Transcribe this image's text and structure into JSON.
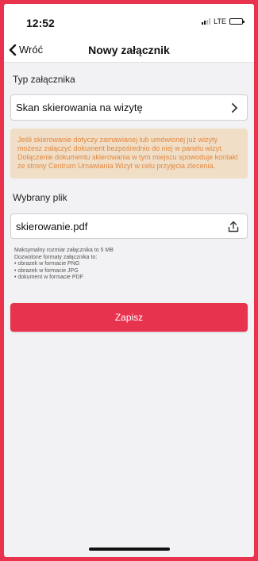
{
  "status": {
    "time": "12:52",
    "network": "LTE"
  },
  "nav": {
    "back_label": "Wróć",
    "title": "Nowy załącznik"
  },
  "attachment_type": {
    "label": "Typ załącznika",
    "value": "Skan skierowania na wizytę"
  },
  "info": {
    "line1": "Jeśli skierowanie dotyczy zamawianej lub umówionej już wizyty możesz załączyć dokument bezpośrednio do niej w panelu wizyt.",
    "line2": "Dołączenie dokumentu skierowania w tym miejscu spowoduje kontakt ze strony Centrum Umawiania Wizyt w celu przyjęcia zlecenia."
  },
  "file": {
    "label": "Wybrany plik",
    "value": "skierowanie.pdf"
  },
  "hints": {
    "max_size": "Maksymalny rozmiar załącznika to 5 MB",
    "formats_header": "Dozwolone formaty załącznika to:",
    "formats": [
      "• obrazek w formacie PNG",
      "• obrazek w formacie JPG",
      "• dokument w formacie PDF"
    ]
  },
  "actions": {
    "save_label": "Zapisz"
  },
  "colors": {
    "accent": "#e8334f",
    "info_bg": "#f1dec6",
    "info_text": "#e2873e"
  },
  "icons": {
    "back": "chevron-left-icon",
    "select": "chevron-right-icon",
    "upload": "upload-icon"
  }
}
